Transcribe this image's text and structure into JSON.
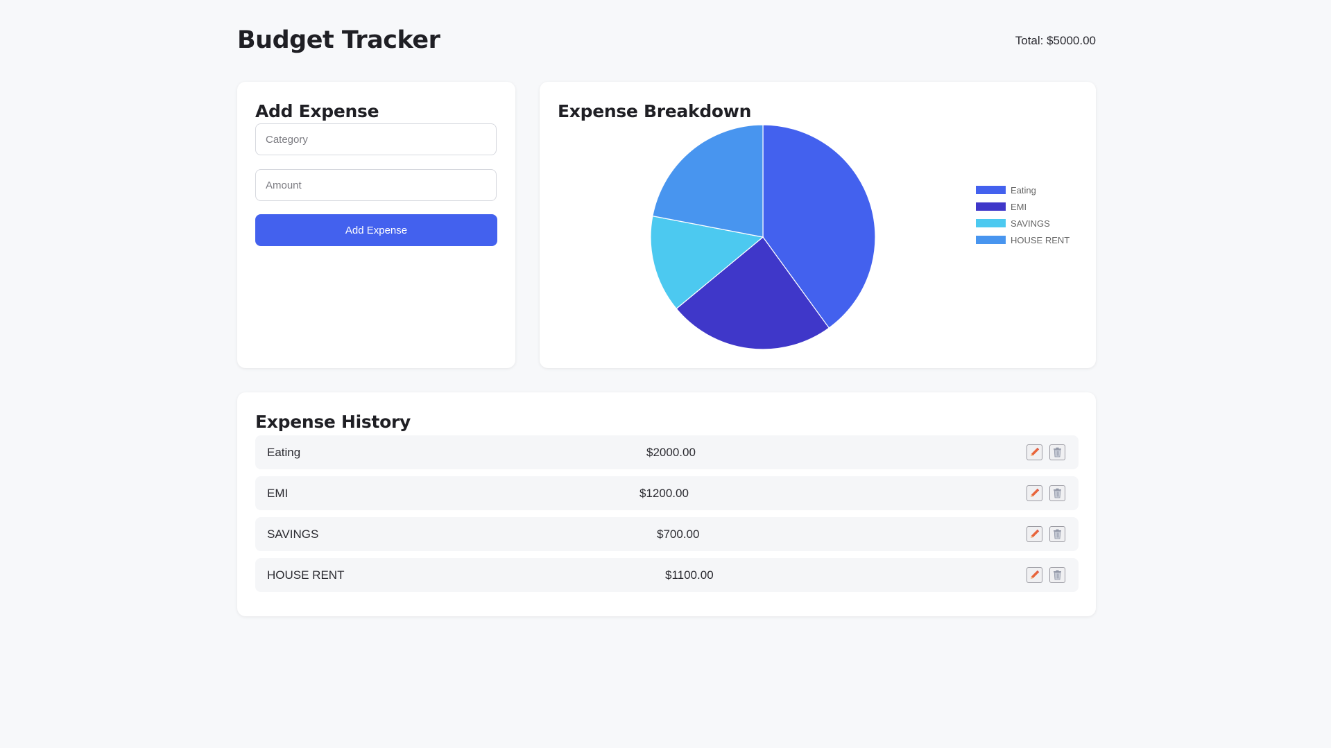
{
  "header": {
    "title": "Budget Tracker",
    "total": "Total: $5000.00"
  },
  "add_expense": {
    "title": "Add Expense",
    "category_placeholder": "Category",
    "amount_placeholder": "Amount",
    "button_label": "Add Expense"
  },
  "breakdown": {
    "title": "Expense Breakdown"
  },
  "chart_data": {
    "type": "pie",
    "title": "Expense Breakdown",
    "categories": [
      "Eating",
      "EMI",
      "SAVINGS",
      "HOUSE RENT"
    ],
    "values": [
      2000,
      1200,
      700,
      1100
    ],
    "colors": [
      "#4361ee",
      "#3f37c9",
      "#4cc9f0",
      "#4895ef"
    ],
    "legend_position": "right"
  },
  "history": {
    "title": "Expense History",
    "rows": [
      {
        "category": "Eating",
        "amount": "$2000.00"
      },
      {
        "category": "EMI",
        "amount": "$1200.00"
      },
      {
        "category": "SAVINGS",
        "amount": "$700.00"
      },
      {
        "category": "HOUSE RENT",
        "amount": "$1100.00"
      }
    ],
    "edit_icon": "pencil-icon",
    "delete_icon": "trash-icon"
  }
}
